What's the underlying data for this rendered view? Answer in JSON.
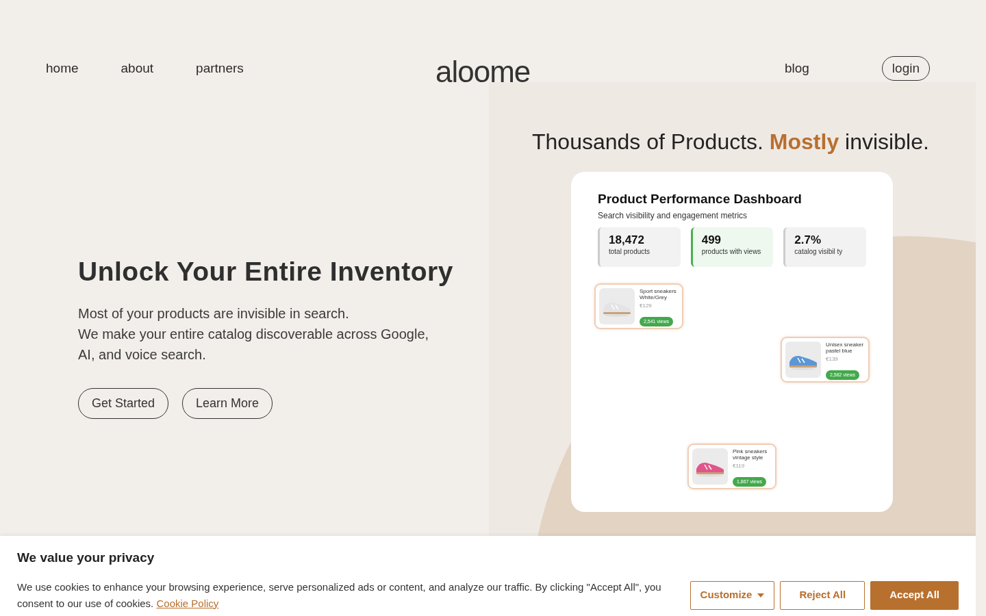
{
  "nav": {
    "left": [
      {
        "label": "home"
      },
      {
        "label": "about"
      },
      {
        "label": "partners"
      }
    ],
    "logo": "aloome",
    "right": [
      {
        "label": "blog",
        "kind": "link"
      },
      {
        "label": "login",
        "kind": "pill"
      }
    ]
  },
  "hero": {
    "title": "Unlock Your Entire Inventory",
    "lines": [
      "Most of your products are invisible in search.",
      "We make your entire catalog discoverable across Google,",
      "AI, and voice search."
    ],
    "buttons": [
      "Get Started",
      "Learn More"
    ]
  },
  "tagline": "Thousands of Products. **Mostly** invisible.",
  "dashboard": {
    "title": "Product Performance Dashboard",
    "subtitle": "Search visibility and engagement metrics",
    "stats": [
      {
        "value": "18,472",
        "label": "total products",
        "color": "#cccccc"
      },
      {
        "value": "499",
        "label": "products with views",
        "color": "#4caf50"
      },
      {
        "value": "2.7%",
        "label": "catalog visibil ty",
        "color": "#cccccc"
      }
    ],
    "slots": [
      {
        "kind": "product",
        "name": "Sport sneakers White/Grey",
        "price": "€129",
        "views": "2,541 views"
      },
      {
        "kind": "empty"
      },
      {
        "kind": "empty"
      },
      {
        "kind": "empty"
      },
      {
        "kind": "empty"
      },
      {
        "kind": "product",
        "name": "Unisex sneaker pastel blue",
        "price": "€139",
        "views": "2,582 views"
      },
      {
        "kind": "empty"
      },
      {
        "kind": "empty"
      },
      {
        "kind": "empty"
      },
      {
        "kind": "empty"
      },
      {
        "kind": "product",
        "name": "Pink sneakers vintage style",
        "price": "€119",
        "views": "1,867 views"
      },
      {
        "kind": "empty"
      }
    ]
  },
  "cookie": {
    "title": "We value your privacy",
    "text": "We use cookies to enhance your browsing experience, serve personalized ads or content, and analyze our traffic. By clicking \"Accept All\", you consent to our use of cookies.",
    "link": "Cookie Policy",
    "buttons": [
      {
        "label": "Customize",
        "kind": "dropdown"
      },
      {
        "label": "Reject All",
        "kind": "outline"
      },
      {
        "label": "Accept All",
        "kind": "primary"
      }
    ]
  }
}
